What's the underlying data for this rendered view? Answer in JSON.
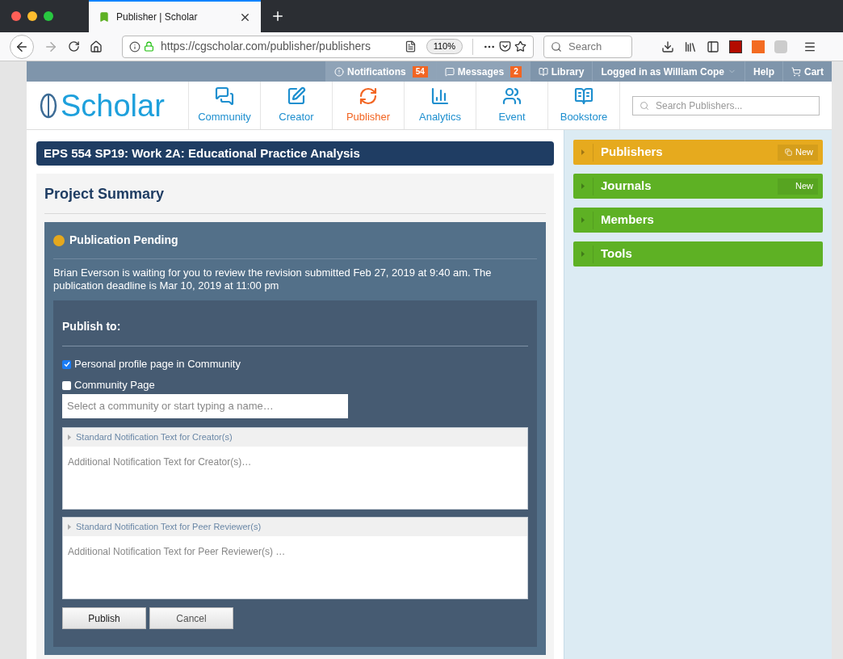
{
  "browser": {
    "tab_title": "Publisher | Scholar",
    "url": "https://cgscholar.com/publisher/publishers",
    "zoom": "110%",
    "search_placeholder": "Search"
  },
  "topbar": {
    "items": [
      {
        "label": "Notifications",
        "badge": "54"
      },
      {
        "label": "Messages",
        "badge": "2"
      },
      {
        "label": "Library"
      },
      {
        "label": "Logged in as William Cope"
      },
      {
        "label": "Help"
      },
      {
        "label": "Cart"
      }
    ]
  },
  "nav": {
    "logo": "Scholar",
    "items": [
      {
        "label": "Community",
        "selected": false
      },
      {
        "label": "Creator",
        "selected": false
      },
      {
        "label": "Publisher",
        "selected": true
      },
      {
        "label": "Analytics",
        "selected": false
      },
      {
        "label": "Event",
        "selected": false
      },
      {
        "label": "Bookstore",
        "selected": false
      }
    ],
    "search_placeholder": "Search Publishers..."
  },
  "main": {
    "title": "EPS 554 SP19: Work 2A: Educational Practice Analysis",
    "heading": "Project Summary",
    "status": {
      "label": "Publication Pending",
      "color": "#e5a81d"
    },
    "message": "Brian Everson is waiting for you to review the revision submitted Feb 27, 2019 at 9:40 am. The publication deadline is Mar 10, 2019 at 11:00 pm",
    "publish_to": {
      "title": "Publish to:",
      "options": [
        {
          "label": "Personal profile page in Community",
          "checked": true
        },
        {
          "label": "Community Page",
          "checked": false
        }
      ],
      "community_placeholder": "Select a community or start typing a name…",
      "notifications": [
        {
          "header": "Standard Notification Text for Creator(s)",
          "placeholder": "Additional Notification Text for Creator(s)…"
        },
        {
          "header": "Standard Notification Text for Peer Reviewer(s)",
          "placeholder": "Additional Notification Text for Peer Reviewer(s) …"
        }
      ],
      "buttons": [
        "Publish",
        "Cancel"
      ]
    }
  },
  "sidebar": {
    "items": [
      {
        "label": "Publishers",
        "color": "#e6aa1e",
        "badge": "New"
      },
      {
        "label": "Journals",
        "color": "#5eb124",
        "badge": "New"
      },
      {
        "label": "Members",
        "color": "#5eb124"
      },
      {
        "label": "Tools",
        "color": "#5eb124"
      }
    ]
  }
}
